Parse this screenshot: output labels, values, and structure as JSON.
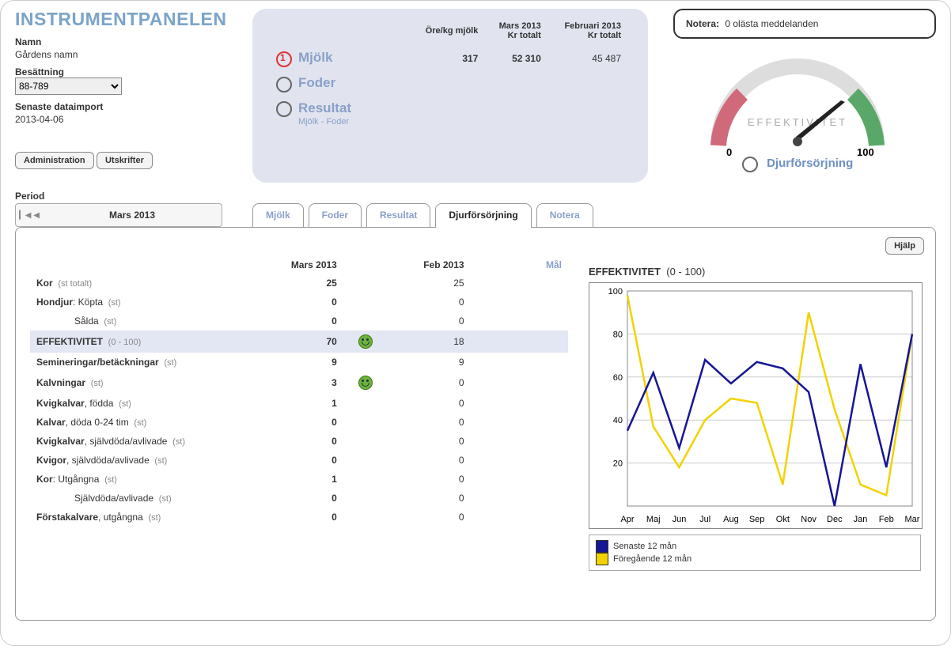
{
  "title": "INSTRUMENTPANELEN",
  "left": {
    "namn_lbl": "Namn",
    "namn": "Gårdens namn",
    "bes_lbl": "Besättning",
    "bes": "88-789",
    "imp_lbl": "Senaste dataimport",
    "imp": "2013-04-06",
    "admin": "Administration",
    "print": "Utskrifter"
  },
  "panel": {
    "h1": "Mars 2013",
    "h2": "Februari 2013",
    "c1": "Öre/kg mjölk",
    "c2": "Kr totalt",
    "c3": "Kr totalt",
    "mjolk": "Mjölk",
    "foder": "Foder",
    "res": "Resultat",
    "res_sub": "Mjölk - Foder",
    "v1": "317",
    "v2": "52 310",
    "v3": "45 487"
  },
  "notera": {
    "lbl": "Notera:",
    "msg": "0 olästa meddelanden"
  },
  "gauge": {
    "lbl": "EFFEKTIVITET",
    "min": "0",
    "max": "100",
    "link": "Djurförsörjning"
  },
  "period": {
    "lbl": "Period",
    "txt": "Mars 2013"
  },
  "tabs": [
    "Mjölk",
    "Foder",
    "Resultat",
    "Djurförsörjning",
    "Notera"
  ],
  "help": "Hjälp",
  "table": {
    "h_cur": "Mars 2013",
    "h_prev": "Feb 2013",
    "h_goal": "Mål",
    "rows": [
      {
        "a": "Kor",
        "b": "(st totalt)",
        "cur": "25",
        "prev": "25"
      },
      {
        "a": "Hondjur: Köpta",
        "b": "(st)",
        "cur": "0",
        "prev": "0"
      },
      {
        "a": "Sålda",
        "b": "(st)",
        "cur": "0",
        "prev": "0",
        "indent": true,
        "noa": true
      },
      {
        "a": "EFFEKTIVITET",
        "b": "(0 - 100)",
        "cur": "70",
        "prev": "18",
        "hl": true,
        "bold": true,
        "smile": true
      },
      {
        "a": "Semineringar/betäckningar",
        "b": "(st)",
        "cur": "9",
        "prev": "9",
        "bold": true
      },
      {
        "a": "Kalvningar",
        "b": "(st)",
        "cur": "3",
        "prev": "0",
        "bold": true,
        "smile": true
      },
      {
        "a": "Kvigkalvar, födda",
        "b": "(st)",
        "cur": "1",
        "prev": "0"
      },
      {
        "a": "Kalvar, döda 0-24 tim",
        "b": "(st)",
        "cur": "0",
        "prev": "0"
      },
      {
        "a": "Kvigkalvar, självdöda/avlivade",
        "b": "(st)",
        "cur": "0",
        "prev": "0"
      },
      {
        "a": "Kvigor, självdöda/avlivade",
        "b": "(st)",
        "cur": "0",
        "prev": "0"
      },
      {
        "a": "Kor: Utgångna",
        "b": "(st)",
        "cur": "1",
        "prev": "0"
      },
      {
        "a": "Självdöda/avlivade",
        "b": "(st)",
        "cur": "0",
        "prev": "0",
        "indent": true,
        "noa": true
      },
      {
        "a": "Förstakalvare, utgångna",
        "b": "(st)",
        "cur": "0",
        "prev": "0"
      }
    ]
  },
  "chart_data": {
    "type": "line",
    "title": "EFFEKTIVITET",
    "title_range": "(0 - 100)",
    "categories": [
      "Apr",
      "Maj",
      "Jun",
      "Jul",
      "Aug",
      "Sep",
      "Okt",
      "Nov",
      "Dec",
      "Jan",
      "Feb",
      "Mar"
    ],
    "series": [
      {
        "name": "Senaste 12 mån",
        "color": "#161694",
        "values": [
          35,
          62,
          27,
          68,
          57,
          67,
          64,
          53,
          0,
          66,
          18,
          80
        ]
      },
      {
        "name": "Föregående 12 mån",
        "color": "#f2d200",
        "values": [
          98,
          37,
          18,
          40,
          50,
          48,
          10,
          90,
          45,
          10,
          5,
          80
        ]
      }
    ],
    "ylim": [
      0,
      100
    ],
    "yticks": [
      20,
      40,
      60,
      80,
      100
    ]
  }
}
